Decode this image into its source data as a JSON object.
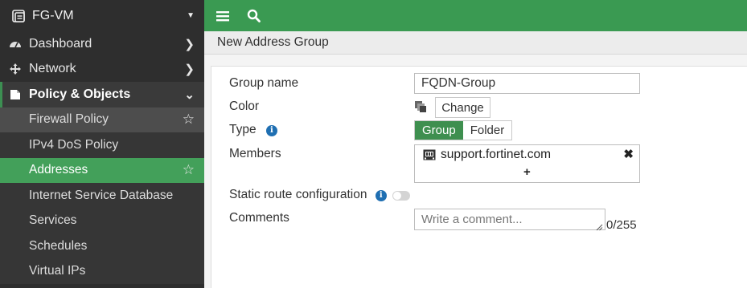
{
  "sidebar": {
    "device_name": "FG-VM",
    "items": [
      {
        "label": "Dashboard",
        "icon": "dashboard-icon"
      },
      {
        "label": "Network",
        "icon": "network-icon"
      },
      {
        "label": "Policy & Objects",
        "icon": "policy-icon"
      }
    ],
    "subitems": [
      {
        "label": "Firewall Policy"
      },
      {
        "label": "IPv4 DoS Policy"
      },
      {
        "label": "Addresses"
      },
      {
        "label": "Internet Service Database"
      },
      {
        "label": "Services"
      },
      {
        "label": "Schedules"
      },
      {
        "label": "Virtual IPs"
      }
    ]
  },
  "topbar": {
    "icons": [
      "menu-icon",
      "search-icon"
    ]
  },
  "page": {
    "title": "New Address Group"
  },
  "form": {
    "group_name_label": "Group name",
    "group_name_value": "FQDN-Group",
    "color_label": "Color",
    "change_button": "Change",
    "type_label": "Type",
    "type_options": {
      "group": "Group",
      "folder": "Folder"
    },
    "type_selected": "Group",
    "members_label": "Members",
    "member_item": "support.fortinet.com",
    "add_symbol": "+",
    "remove_symbol": "✖",
    "static_route_label": "Static route configuration",
    "static_route_enabled": false,
    "comments_label": "Comments",
    "comments_placeholder": "Write a comment...",
    "comments_counter": "0/255"
  },
  "colors": {
    "accent": "#3a9a52",
    "sidebar_bg": "#2e2e2e",
    "active_item": "#43a05a"
  }
}
